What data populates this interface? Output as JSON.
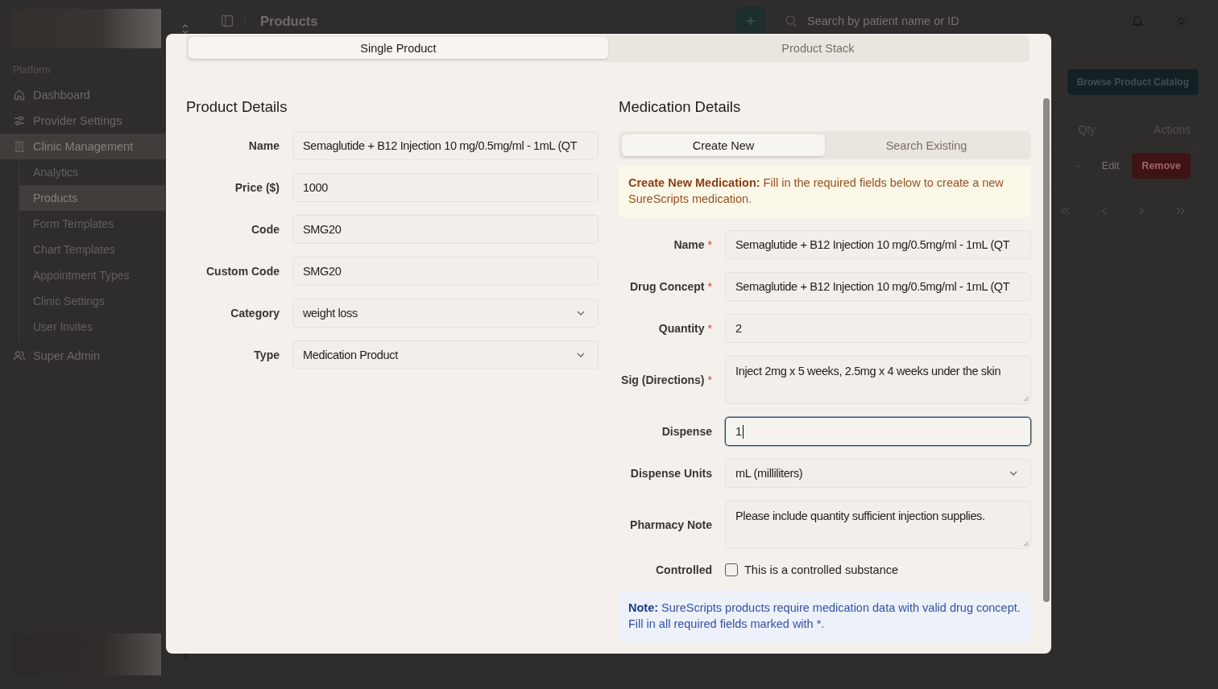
{
  "sidebar": {
    "section_label": "Platform",
    "items": [
      {
        "label": "Dashboard",
        "selected": false
      },
      {
        "label": "Provider Settings",
        "selected": false
      },
      {
        "label": "Clinic Management",
        "selected": true,
        "children": [
          {
            "label": "Analytics",
            "selected": false
          },
          {
            "label": "Products",
            "selected": true
          },
          {
            "label": "Form Templates",
            "selected": false
          },
          {
            "label": "Chart Templates",
            "selected": false
          },
          {
            "label": "Appointment Types",
            "selected": false
          },
          {
            "label": "Clinic Settings",
            "selected": false
          },
          {
            "label": "User Invites",
            "selected": false
          }
        ]
      },
      {
        "label": "Super Admin",
        "selected": false
      }
    ]
  },
  "header": {
    "title": "Products",
    "search": {
      "placeholder": "Search by patient name or ID"
    }
  },
  "page": {
    "catalog_button": "Browse Product Catalog",
    "table": {
      "columns": [
        "Qty",
        "Actions"
      ],
      "rows": [
        {
          "qty": "-",
          "edit": "Edit",
          "remove": "Remove"
        }
      ]
    }
  },
  "dialog": {
    "tabs": [
      {
        "label": "Single Product",
        "selected": true
      },
      {
        "label": "Product Stack",
        "selected": false
      }
    ],
    "product_details": {
      "title": "Product Details",
      "fields": [
        {
          "label": "Name",
          "kind": "text",
          "value": "Semaglutide + B12 Injection 10 mg/0.5mg/ml - 1mL (QT"
        },
        {
          "label": "Price ($)",
          "kind": "text",
          "value": "1000"
        },
        {
          "label": "Code",
          "kind": "text",
          "value": "SMG20"
        },
        {
          "label": "Custom Code",
          "kind": "text",
          "value": "SMG20"
        },
        {
          "label": "Category",
          "kind": "select",
          "value": "weight loss"
        },
        {
          "label": "Type",
          "kind": "select",
          "value": "Medication Product"
        }
      ]
    },
    "medication_details": {
      "title": "Medication Details",
      "tabs": [
        {
          "label": "Create New",
          "selected": true
        },
        {
          "label": "Search Existing",
          "selected": false
        }
      ],
      "notice": "**Create New Medication:** Fill in the required fields below to create a new SureScripts medication.",
      "required_mark": "*",
      "fields": [
        {
          "label": "Name",
          "kind": "text",
          "required": true,
          "focused": false,
          "value": "Semaglutide + B12 Injection 10 mg/0.5mg/ml - 1mL (QT"
        },
        {
          "label": "Drug Concept",
          "kind": "text",
          "required": true,
          "focused": false,
          "value": "Semaglutide + B12 Injection 10 mg/0.5mg/ml - 1mL (QT"
        },
        {
          "label": "Quantity",
          "kind": "text",
          "required": true,
          "focused": false,
          "value": "2"
        },
        {
          "label": "Sig (Directions)",
          "kind": "textarea",
          "required": true,
          "focused": false,
          "value": "Inject 2mg x 5 weeks, 2.5mg x 4 weeks under the skin"
        },
        {
          "label": "Dispense",
          "kind": "text",
          "required": false,
          "focused": true,
          "value": "1"
        },
        {
          "label": "Dispense Units",
          "kind": "select",
          "required": false,
          "focused": false,
          "value": "mL (milliliters)"
        },
        {
          "label": "Pharmacy Note",
          "kind": "textarea",
          "required": false,
          "focused": false,
          "value": "Please include quantity sufficient injection supplies."
        },
        {
          "label": "Controlled",
          "kind": "checkbox",
          "text": "This is a controlled substance",
          "checked": false
        }
      ],
      "note": "**Note:** SureScripts products require medication data with valid drug concept. Fill in all required fields marked with *."
    }
  }
}
